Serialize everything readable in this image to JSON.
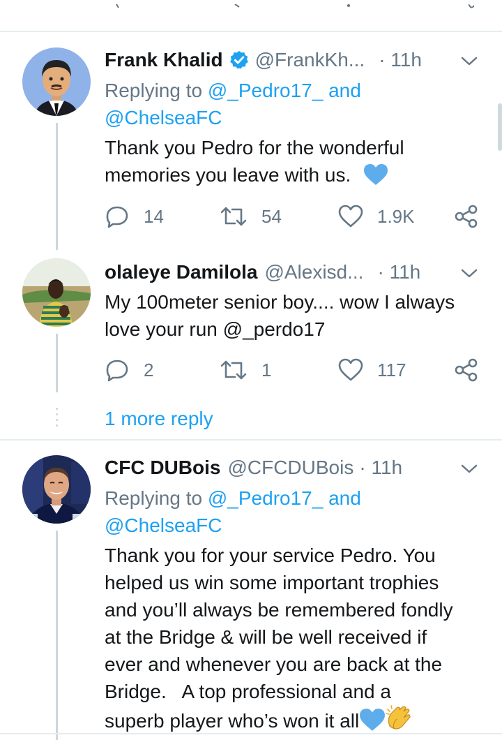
{
  "colors": {
    "link": "#1da1f2",
    "secondary": "#657786",
    "text": "#14171a",
    "separator": "#e6ecf0",
    "heart_blue": "#5dadec"
  },
  "tweets": [
    {
      "name": "Frank Khalid",
      "verified": true,
      "handle": "@FrankKh...",
      "time": "· 11h",
      "replying_prefix": "Replying to ",
      "replying_links": "@_Pedro17_ and",
      "replying_links_2": "@ChelseaFC",
      "body_line1": "Thank you Pedro for the wonderful",
      "body_line2": "memories you leave with us.",
      "emoji": "blue-heart",
      "replies": "14",
      "retweets": "54",
      "likes": "1.9K",
      "avatar": "cartoon-man-avatar"
    },
    {
      "name": "olaleye Damilola",
      "handle": "@Alexisd...",
      "time": "· 11h",
      "body_line1": "My 100meter senior boy.... wow I always",
      "body_line2": "love your run @_perdo17",
      "replies": "2",
      "retweets": "1",
      "likes": "117",
      "avatar": "young-man-photo-avatar"
    },
    {
      "name": "CFC DUBois",
      "handle": "@CFCDUBois",
      "time": "· 11h",
      "replying_prefix": "Replying to ",
      "replying_links": "@_Pedro17_ and",
      "replying_links_2": "@ChelseaFC",
      "body_lines": [
        "Thank you for your service Pedro. You",
        "helped us win some important trophies",
        "and you’ll always be remembered fondly",
        "at the Bridge & will be well received if",
        "ever and whenever you are back at the",
        "Bridge.   A top professional and a",
        "superb player who’s won it all"
      ],
      "emojis": [
        "blue-heart",
        "clapping-hands"
      ],
      "avatar": "smiling-man-photo-avatar"
    }
  ],
  "more_replies_label": "1 more reply"
}
